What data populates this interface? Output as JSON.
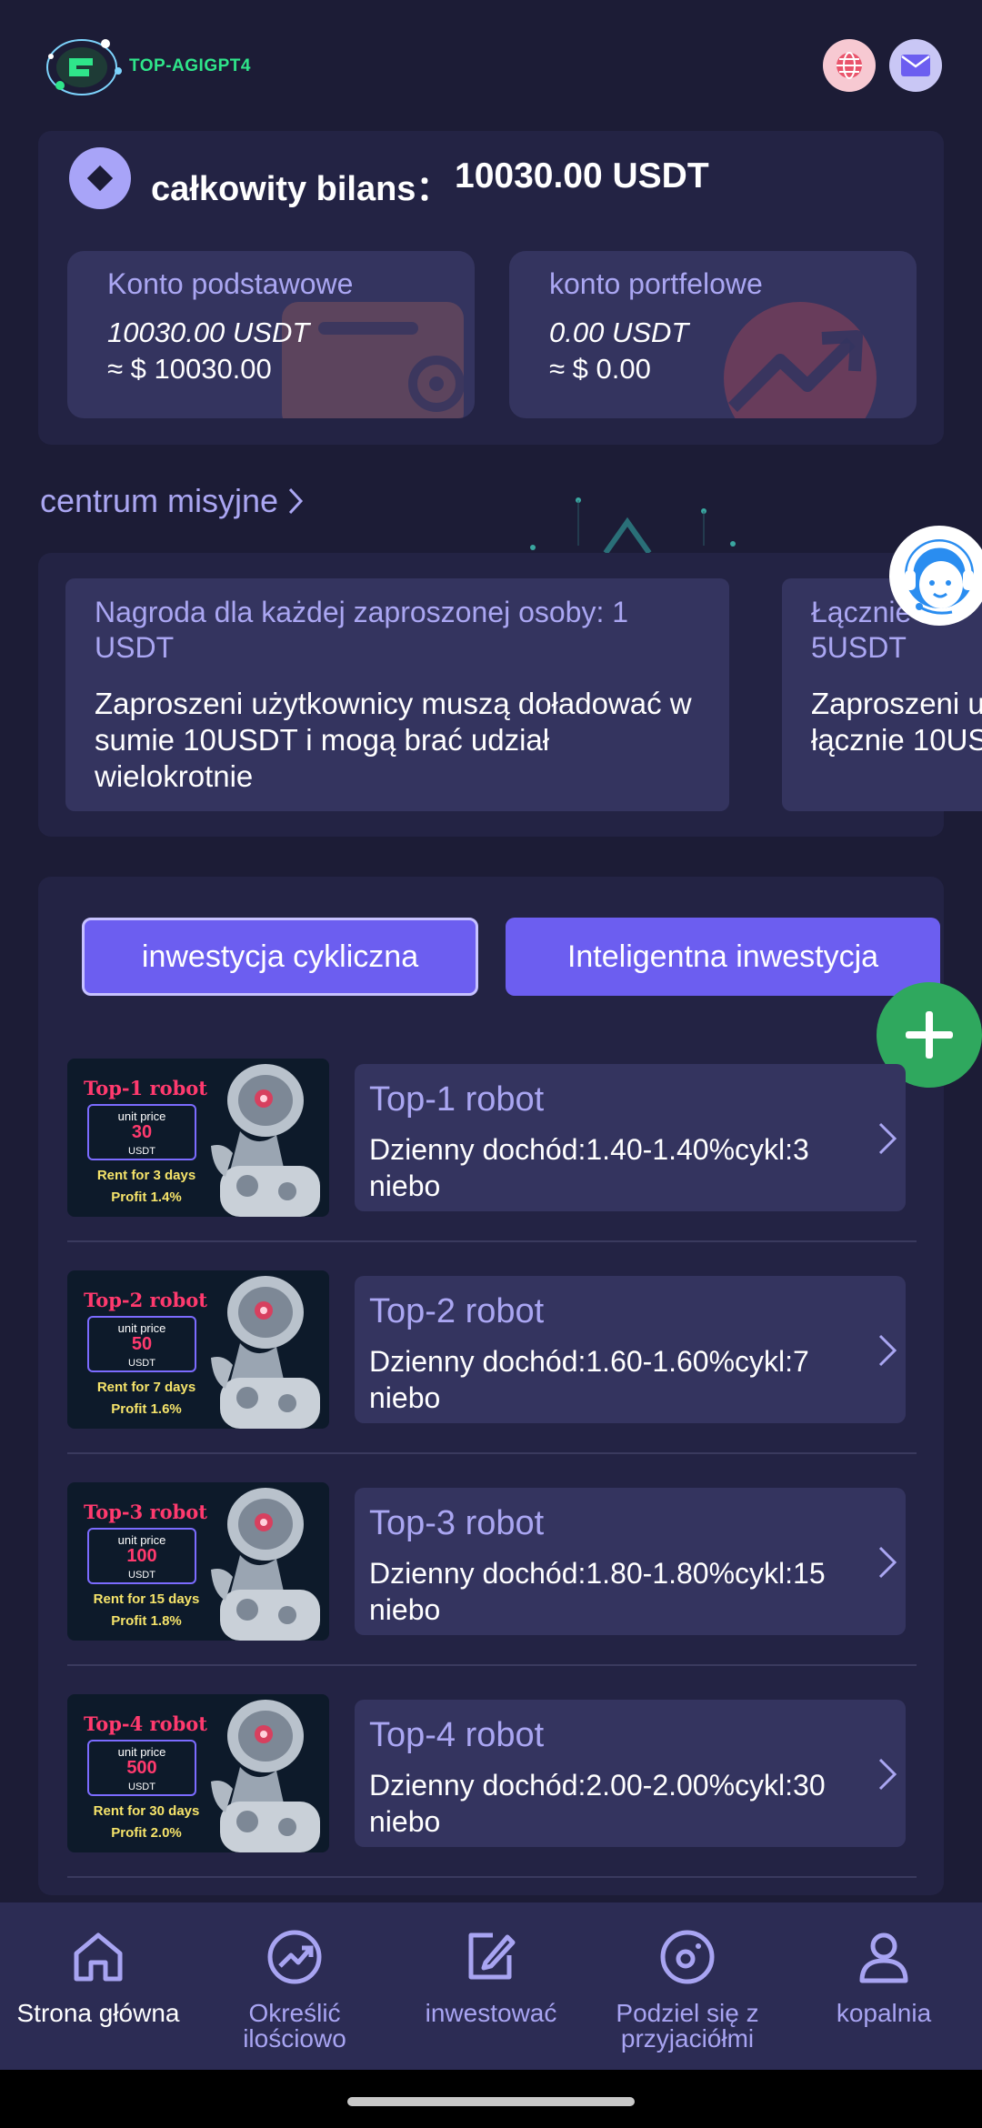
{
  "header": {
    "logo_text": "TOP-AGIGPT4",
    "icons": [
      "globe-icon",
      "mail-icon"
    ]
  },
  "balance": {
    "label": "całkowity bilans：",
    "value": "10030.00 USDT",
    "accounts": [
      {
        "title": "Konto podstawowe",
        "amount": "10030.00 USDT",
        "approx": "≈ $ 10030.00"
      },
      {
        "title": "konto portfelowe",
        "amount": "0.00 USDT",
        "approx": "≈ $ 0.00"
      }
    ]
  },
  "mission": {
    "title": "centrum misyjne",
    "tasks": [
      {
        "title": "Nagroda dla każdej zaproszonej osoby: 1 USDT",
        "desc": "Zaproszeni użytkownicy muszą doładować w sumie 10USDT i mogą brać udział wielokrotnie"
      },
      {
        "title": "Łącznie 5USDT",
        "desc": "Zaproszeni u łącznie 10US"
      }
    ]
  },
  "invest": {
    "tabs": [
      "inwestycja cykliczna",
      "Inteligentna inwestycja"
    ],
    "robots": [
      {
        "name": "Top-1 robot",
        "desc": "Dzienny dochód:1.40-1.40%cykl:3 niebo",
        "img_title": "Top-1 robot",
        "unit_price_label": "unit price",
        "price": "30",
        "currency": "USDT",
        "rent": "Rent for 3 days",
        "profit": "Profit 1.4%"
      },
      {
        "name": "Top-2 robot",
        "desc": "Dzienny dochód:1.60-1.60%cykl:7 niebo",
        "img_title": "Top-2 robot",
        "unit_price_label": "unit price",
        "price": "50",
        "currency": "USDT",
        "rent": "Rent for 7 days",
        "profit": "Profit 1.6%"
      },
      {
        "name": "Top-3 robot",
        "desc": "Dzienny dochód:1.80-1.80%cykl:15 niebo",
        "img_title": "Top-3 robot",
        "unit_price_label": "unit price",
        "price": "100",
        "currency": "USDT",
        "rent": "Rent for 15 days",
        "profit": "Profit 1.8%"
      },
      {
        "name": "Top-4 robot",
        "desc": "Dzienny dochód:2.00-2.00%cykl:30 niebo",
        "img_title": "Top-4 robot",
        "unit_price_label": "unit price",
        "price": "500",
        "currency": "USDT",
        "rent": "Rent for 30 days",
        "profit": "Profit 2.0%"
      }
    ]
  },
  "nav": {
    "items": [
      {
        "label": "Strona główna",
        "icon": "home-icon",
        "active": true
      },
      {
        "label": "Określić ilościowo",
        "icon": "chart-icon",
        "active": false
      },
      {
        "label": "inwestować",
        "icon": "edit-icon",
        "active": false
      },
      {
        "label": "Podziel się z przyjaciółmi",
        "icon": "share-icon",
        "active": false
      },
      {
        "label": "kopalnia",
        "icon": "user-icon",
        "active": false
      }
    ]
  },
  "colors": {
    "background": "#1c1c36",
    "card": "#232344",
    "panel": "#34345f",
    "accent": "#6c5ef0",
    "label": "#aaa6f2",
    "add_button": "#2fa85e"
  }
}
